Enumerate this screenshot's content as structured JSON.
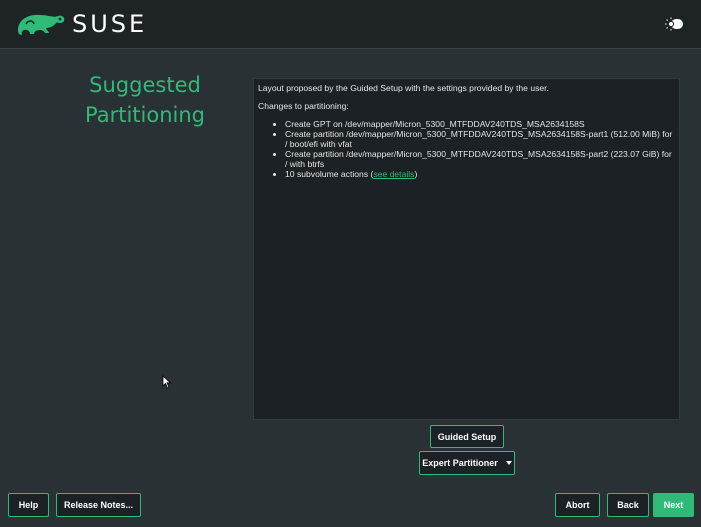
{
  "header": {
    "brand": "SUSE",
    "logo_icon": "chameleon-icon",
    "theme_icon": "sun-toggle-icon"
  },
  "title": {
    "line1": "Suggested",
    "line2": "Partitioning"
  },
  "summary": {
    "intro": "Layout proposed by the Guided Setup with the settings provided by the user.",
    "changes_heading": "Changes to partitioning:",
    "items": [
      "Create GPT on /dev/mapper/Micron_5300_MTFDDAV240TDS_MSA2634158S",
      "Create partition /dev/mapper/Micron_5300_MTFDDAV240TDS_MSA2634158S-part1 (512.00 MiB) for / boot/efi with vfat",
      "Create partition /dev/mapper/Micron_5300_MTFDDAV240TDS_MSA2634158S-part2 (223.07 GiB) for / with btrfs"
    ],
    "subvolume_text": "10 subvolume actions (",
    "see_details": "see details",
    "subvolume_close": ")"
  },
  "buttons": {
    "guided_setup": "Guided Setup",
    "expert_partitioner": "Expert Partitioner",
    "help": "Help",
    "release_notes": "Release Notes...",
    "abort": "Abort",
    "back": "Back",
    "next": "Next"
  },
  "colors": {
    "accent": "#30ba78",
    "background": "#2a3134",
    "panel": "#1b2124"
  }
}
